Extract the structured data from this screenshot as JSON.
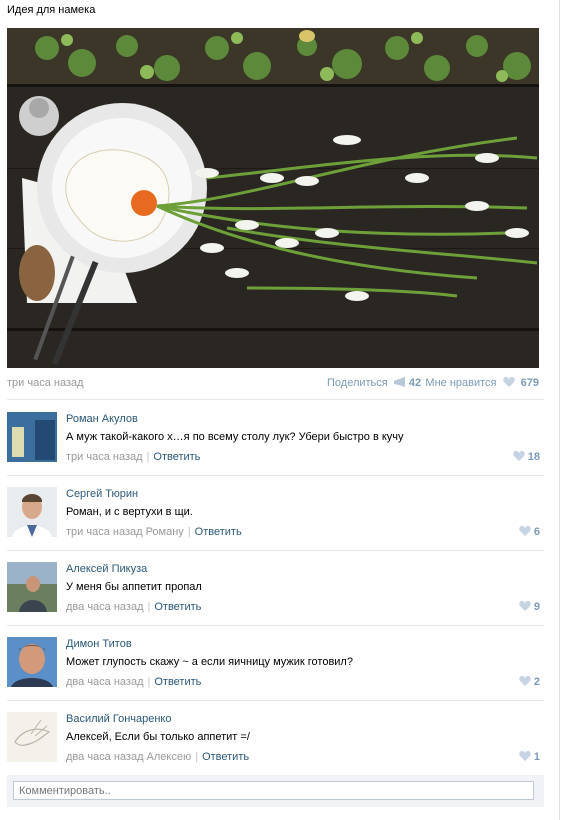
{
  "post": {
    "text": "Идея для намека",
    "time": "три часа назад",
    "share_label": "Поделиться",
    "share_count": "42",
    "like_label": "Мне нравится",
    "like_count": "679"
  },
  "comments": [
    {
      "author": "Роман Акулов",
      "text": "А муж такой-какого х…я по всему столу лук? Убери быстро в кучу",
      "time": "три часа назад",
      "reply": "Ответить",
      "likes": "18"
    },
    {
      "author": "Сергей Тюрин",
      "text": "Роман, и с вертухи в щи.",
      "time": "три часа назад Роману",
      "reply": "Ответить",
      "likes": "6"
    },
    {
      "author": "Алексей Пикуза",
      "text": "У меня бы аппетит пропал",
      "time": "два часа назад",
      "reply": "Ответить",
      "likes": "9"
    },
    {
      "author": "Димон Титов",
      "text": "Может глупость скажу ~ а если яичницу мужик готовил?",
      "time": "два часа назад",
      "reply": "Ответить",
      "likes": "2"
    },
    {
      "author": "Василий Гончаренко",
      "text": "Алексей, Если бы только аппетит =/",
      "time": "два часа назад Алексею",
      "reply": "Ответить",
      "likes": "1"
    }
  ],
  "comment_input": {
    "placeholder": "Комментировать.."
  },
  "colors": {
    "link": "#2b587a",
    "muted": "#999999",
    "accent": "#7b9ab6",
    "separator": "#e7eaed"
  }
}
